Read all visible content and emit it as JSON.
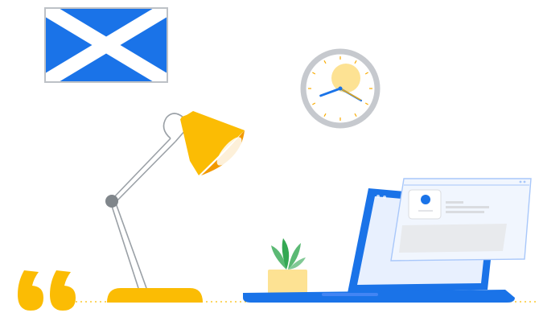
{
  "scene": {
    "description_free": true,
    "colors": {
      "flag_blue": "#1A73E8",
      "flag_cross": "#FFFFFF",
      "frame_grey": "#BDC1C6",
      "lamp_yellow": "#FBBC04",
      "lamp_orange": "#F29900",
      "lamp_arm": "#9AA0A6",
      "lamp_joint": "#80868B",
      "clock_rim": "#C6C9CE",
      "clock_sun": "#FDE293",
      "clock_hand": "#1A73E8",
      "clock_hand_alt": "#F9AB00",
      "laptop_blue": "#1A73E8",
      "laptop_screen": "#E8F0FE",
      "window_bg": "#F1F6FE",
      "window_border": "#A8C7FA",
      "dot_blue": "#1A73E8",
      "line_grey": "#DADCE0",
      "plant_green": "#5BB974",
      "pot_yellow": "#FDE293",
      "quote_yellow": "#FBBC04",
      "floor_dots": "#FBBC04"
    },
    "icons": {
      "flag": "scottish-flag-icon",
      "lamp": "desk-lamp-icon",
      "clock": "wall-clock-icon",
      "laptop": "laptop-icon",
      "plant": "potted-plant-icon",
      "quote": "quote-mark-icon"
    },
    "clock_time": {
      "hour": 8,
      "minute": 20
    }
  }
}
